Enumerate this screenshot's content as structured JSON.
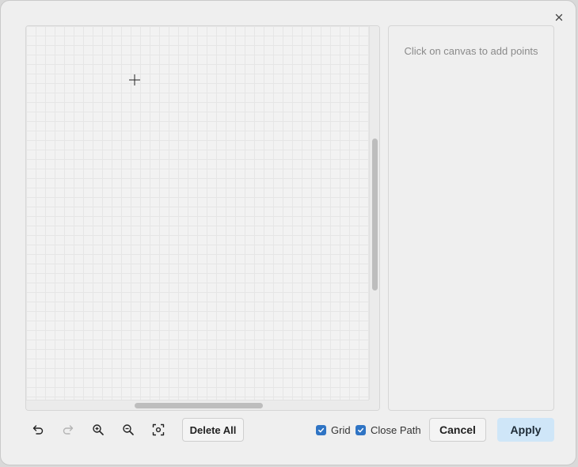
{
  "dialog": {
    "close_label": "×",
    "points_hint": "Click on canvas to add points"
  },
  "canvas": {
    "cursor_icon": "crosshair-icon",
    "grid_visible": true,
    "vertical_scroll": 0.3,
    "horizontal_scroll": 0.32
  },
  "toolbar": {
    "undo_icon": "undo-icon",
    "redo_icon": "redo-icon",
    "redo_enabled": false,
    "zoom_in_icon": "zoom-in-icon",
    "zoom_out_icon": "zoom-out-icon",
    "fit_icon": "fit-to-screen-icon",
    "delete_all_label": "Delete All",
    "grid_label": "Grid",
    "grid_checked": true,
    "close_path_label": "Close Path",
    "close_path_checked": true,
    "cancel_label": "Cancel",
    "apply_label": "Apply"
  },
  "colors": {
    "accent": "#2f74c4",
    "apply_bg": "#cfe6f8"
  }
}
